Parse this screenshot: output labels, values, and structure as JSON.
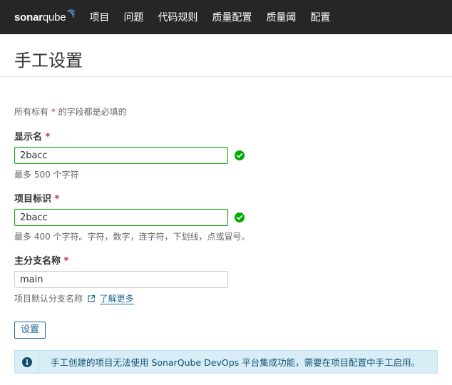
{
  "nav": {
    "logo_bold": "sonar",
    "logo_light": "qube",
    "items": [
      "项目",
      "问题",
      "代码规则",
      "质量配置",
      "质量阈",
      "配置"
    ]
  },
  "page": {
    "title": "手工设置"
  },
  "form": {
    "required_note_prefix": "所有标有",
    "required_note_star": "*",
    "required_note_suffix": "的字段都是必填的",
    "display_name": {
      "label": "显示名",
      "value": "2bacc",
      "help": "最多 500 个字符"
    },
    "project_key": {
      "label": "项目标识",
      "value": "2bacc",
      "help": "最多 400 个字符。字符，数字，连字符，下划线，点或冒号。"
    },
    "main_branch": {
      "label": "主分支名称",
      "value": "main",
      "help": "项目默认分支名称",
      "learn_more": "了解更多"
    },
    "submit_label": "设置"
  },
  "alert": {
    "text": "手工创建的项目无法使用 SonarQube DevOps 平台集成功能，需要在项目配置中手工启用。"
  },
  "colors": {
    "topbar": "#262626",
    "required": "#d02f3a",
    "valid": "#00aa00",
    "link": "#236a97",
    "alert_bg": "#d9edf7"
  }
}
